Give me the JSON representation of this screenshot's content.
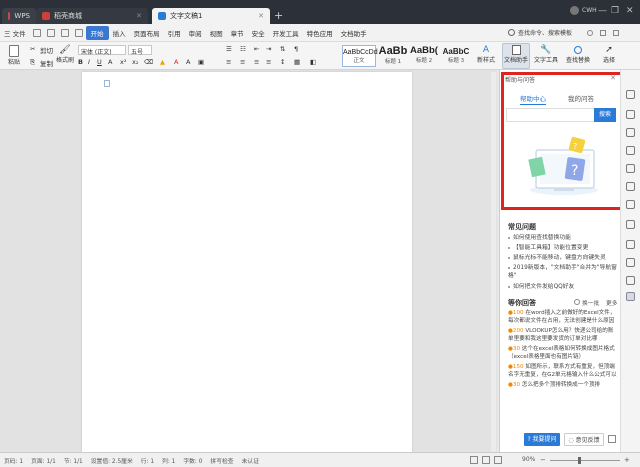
{
  "titlebar": {
    "tabs": [
      {
        "label": "WPS",
        "icon": "wps-logo-icon"
      },
      {
        "label": "稻壳商城",
        "icon": "store-icon"
      },
      {
        "label": "文字文稿1",
        "icon": "document-icon"
      }
    ],
    "add_tab": "+",
    "window_controls": [
      "—",
      "❐",
      "✕"
    ],
    "user": "CWH"
  },
  "menubar": {
    "file": "三 文件",
    "items": [
      "开始",
      "插入",
      "页面布局",
      "引用",
      "审阅",
      "视图",
      "章节",
      "安全",
      "开发工具",
      "特色应用",
      "文档助手"
    ],
    "search": "查找命令、搜索模板",
    "sync_label": "未同步",
    "collab_label": "协作",
    "share_label": "分享"
  },
  "ribbon": {
    "paste": "粘贴",
    "cut": "剪切",
    "copy": "复制",
    "format_painter": "格式刷",
    "font_name": "宋体 (正文)",
    "font_size": "五号",
    "styles": [
      {
        "sample": "AaBbCcDd",
        "name": "正文"
      },
      {
        "sample": "AaBb",
        "name": "标题 1"
      },
      {
        "sample": "AaBb(",
        "name": "标题 2"
      },
      {
        "sample": "AaBbC",
        "name": "标题 3"
      }
    ],
    "new_style": "新样式",
    "doc_assistant": "文档助手",
    "text_tools": "文字工具",
    "find_replace": "查找替换",
    "select": "选择"
  },
  "panel": {
    "title": "帮助与问答",
    "tab_help": "帮助中心",
    "tab_mine": "我的问答",
    "search_button": "搜索",
    "faq_title": "常见问题",
    "faq": [
      "如何使用查找替换功能",
      "【智能工具箱】功能位置变更",
      "鼠标光标不能移动，键盘方向键失灵",
      "2019新版本，\"文档助手\"合并为\"导航窗格\"",
      "如何把文件发给QQ好友"
    ],
    "reward_title": "等你回答",
    "refresh": "换一批",
    "more": "更多",
    "rewards": [
      {
        "points": "100",
        "text": "在word插入之前做好的Excel文件，每次都说文件在占用，无法创建是什么原因"
      },
      {
        "points": "200",
        "text": "VLOOKUP怎么用？快递公司给的账单里要和我这里要发货的订单对比哪"
      },
      {
        "points": "30",
        "text": "这个在excel表格如何转换成图片格式（excel表格里面也有图片链）"
      },
      {
        "points": "150",
        "text": "如图所示，联系方式有重复，但顶端名字无重复，在G2单元格输入什么公式可以"
      },
      {
        "points": "30",
        "text": "怎么把多个顶排转换成一个顶排"
      }
    ],
    "ask_button": "我要提问",
    "feedback_button": "意见反馈"
  },
  "statusbar": {
    "page": "页码: 1",
    "pages": "页面: 1/1",
    "section": "节: 1/1",
    "setting": "设置值: 2.5厘米",
    "row": "行: 1",
    "col": "列: 1",
    "words": "字数: 0",
    "spell": "拼写检查",
    "cert": "未认证",
    "zoom": "90%"
  },
  "colors": {
    "accent": "#2a7ad8",
    "highlight": "#e0231e",
    "titlebar": "#2c3038",
    "reward_points": "#f08a00"
  }
}
